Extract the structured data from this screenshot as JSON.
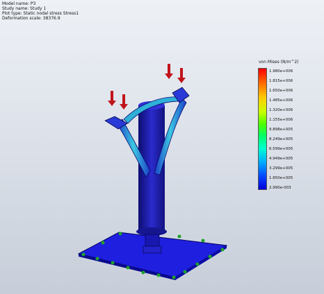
{
  "info": {
    "model_name": "Model name: P3",
    "study_name": "Study name: Study 1",
    "plot_type": "Plot type: Static nodal stress Stress1",
    "deformation_scale": "Deformation scale: 38376.9"
  },
  "legend": {
    "title": "von Mises (N/m^2)",
    "values": [
      "1.980e+006",
      "1.815e+006",
      "1.650e+006",
      "1.485e+006",
      "1.320e+006",
      "1.155e+006",
      "9.898e+005",
      "8.249e+005",
      "6.599e+005",
      "4.949e+005",
      "3.299e+005",
      "1.650e+005",
      "2.990e-003"
    ],
    "colors": [
      "#ff0000",
      "#ff6a00",
      "#ffcc00",
      "#4cff00",
      "#00ffd0",
      "#00a8ff",
      "#0000d8"
    ]
  },
  "colors": {
    "base_plate": "#1f1fe0",
    "column": "#1a1aa8",
    "arm_highlight": "#40e0d0",
    "load_arrow": "#c0141a",
    "fixture": "#1fa32a"
  }
}
